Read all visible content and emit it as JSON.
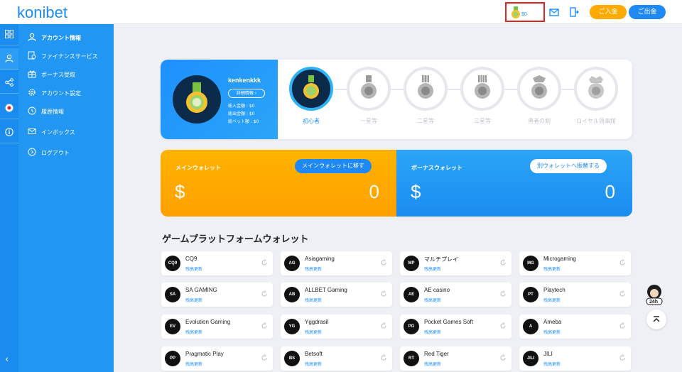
{
  "header": {
    "logo_text": "konibet",
    "balance": "$0",
    "deposit_label": "ご入金",
    "withdraw_label": "ご出金"
  },
  "sidebar": {
    "items": [
      {
        "label": "アカウント情報",
        "icon": "user-icon"
      },
      {
        "label": "ファイナンスサービス",
        "icon": "finance-icon"
      },
      {
        "label": "ボーナス受取",
        "icon": "gift-icon"
      },
      {
        "label": "アカウント設定",
        "icon": "gear-icon"
      },
      {
        "label": "履歴情報",
        "icon": "history-icon"
      },
      {
        "label": "インボックス",
        "icon": "mail-icon"
      },
      {
        "label": "ログアウト",
        "icon": "logout-icon"
      }
    ],
    "collapse": "‹"
  },
  "profile": {
    "username": "kenkenkkk",
    "detail_label": "詳細情報 ›",
    "stats": [
      "総入金額 : $0",
      "総出金額 : $0",
      "総ベット額 : $0"
    ],
    "levels": [
      "初心者",
      "一星等",
      "二星等",
      "三星等",
      "勇者の剣",
      "ロイヤル領事館"
    ],
    "current_level_index": 0
  },
  "wallets": {
    "main": {
      "title": "メインウォレット",
      "button": "メインウォレットに移す",
      "currency": "$",
      "value": "0"
    },
    "bonus": {
      "title": "ボーナスウォレット",
      "button": "別ウォレットへ振替する",
      "currency": "$",
      "value": "0"
    }
  },
  "platforms": {
    "title": "ゲームプラットフォームウォレット",
    "update_label": "残高更新",
    "items": [
      {
        "name": "CQ9",
        "logo": "CQ9"
      },
      {
        "name": "Asiagaming",
        "logo": "AG"
      },
      {
        "name": "マルチプレイ",
        "logo": "MP"
      },
      {
        "name": "Microgaming",
        "logo": "MG"
      },
      {
        "name": "SA GAMING",
        "logo": "SA"
      },
      {
        "name": "ALLBET Gaming",
        "logo": "AB"
      },
      {
        "name": "AE casino",
        "logo": "AE"
      },
      {
        "name": "Playtech",
        "logo": "PT"
      },
      {
        "name": "Evolution Gaming",
        "logo": "EV"
      },
      {
        "name": "Yggdrasil",
        "logo": "YG"
      },
      {
        "name": "Pocket Games Soft",
        "logo": "PG"
      },
      {
        "name": "Ameba",
        "logo": "A"
      },
      {
        "name": "Pragmatic Play",
        "logo": "PP"
      },
      {
        "name": "Betsoft",
        "logo": "BS"
      },
      {
        "name": "Red Tiger",
        "logo": "RT"
      },
      {
        "name": "JILI",
        "logo": "JILI"
      }
    ]
  },
  "colors": {
    "primary": "#2196f3",
    "accent": "#ffa000",
    "highlight": "#e32222"
  }
}
